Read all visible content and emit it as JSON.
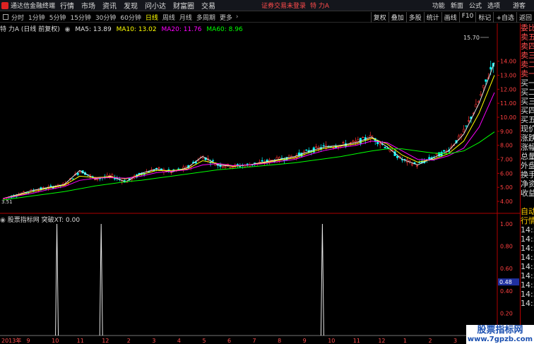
{
  "app": {
    "title": "通达信金融终端"
  },
  "menu": [
    "行情",
    "市场",
    "资讯",
    "发现",
    "问小达",
    "财富圈",
    "交易"
  ],
  "notice": "证券交易未登录",
  "stock_name": "特 力A",
  "top_right": [
    "功能",
    "新面",
    "公式",
    "选项"
  ],
  "guest": "游客",
  "periods": [
    "分时",
    "1分钟",
    "5分钟",
    "15分钟",
    "30分钟",
    "60分钟",
    "日线",
    "周线",
    "月线",
    "多周期",
    "更多"
  ],
  "active_period": "日线",
  "tools": [
    "复权",
    "叠加",
    "多股",
    "统计",
    "画线",
    "F10",
    "标记",
    "+自选",
    "返回"
  ],
  "info": {
    "title": "特 力A (日线 前复权)",
    "ma5": "MA5: 13.89",
    "ma10": "MA10: 13.02",
    "ma20": "MA20: 11.76",
    "ma60": "MA60: 8.96"
  },
  "indicator": {
    "title": "股票指标网",
    "line": "突破XT: 0.00",
    "current_value": "0.48",
    "y_labels": [
      "1.00",
      "0.80",
      "0.60",
      "0.40",
      "0.20"
    ]
  },
  "price_axis": [
    "14.00",
    "13.00",
    "12.00",
    "11.00",
    "10.00",
    "9.00",
    "8.00",
    "7.00",
    "6.00",
    "5.00",
    "4.00"
  ],
  "peak_label": "15.70",
  "low_label": "3.51",
  "quote_panel": [
    "委比",
    "卖五",
    "卖四",
    "卖三",
    "卖二",
    "卖一",
    "买一",
    "买二",
    "买三",
    "买四",
    "买五",
    "现价",
    "涨跌",
    "涨幅",
    "总量",
    "外盘",
    "换手",
    "净资",
    "收益",
    "",
    "自动",
    "行情",
    "14:56",
    "14:56",
    "14:56",
    "14:56",
    "14:56",
    "14:56",
    "14:56",
    "14:56",
    "14:56"
  ],
  "date_axis": [
    "2013年",
    "9",
    "10",
    "11",
    "12",
    "2",
    "3",
    "4",
    "5",
    "6",
    "7",
    "8",
    "9",
    "10",
    "11",
    "12",
    "1",
    "2",
    "3"
  ],
  "watermark": {
    "line1": "股票指标网",
    "line2": "www.7gpzb.com"
  },
  "colors": {
    "up": "#ff3030",
    "down": "#00ffff",
    "ma5": "#e0e0e0",
    "ma10": "#ffff00",
    "ma20": "#ff00ff",
    "ma60": "#00ff00",
    "axis": "#b00000"
  },
  "chart_data": {
    "type": "line",
    "series": [
      {
        "name": "MA5",
        "values": [
          4.2,
          4.5,
          4.8,
          5.0,
          5.2,
          6.2,
          5.6,
          5.8,
          5.4,
          6.0,
          6.3,
          6.1,
          6.4,
          7.2,
          6.6,
          6.5,
          6.6,
          6.8,
          7.0,
          7.2,
          7.6,
          7.9,
          8.0,
          8.2,
          8.6,
          7.9,
          7.0,
          6.6,
          7.1,
          7.6,
          8.8,
          11.0,
          13.9
        ]
      },
      {
        "name": "MA10",
        "values": [
          4.2,
          4.45,
          4.7,
          4.95,
          5.15,
          5.8,
          5.7,
          5.75,
          5.6,
          5.9,
          6.2,
          6.2,
          6.3,
          6.9,
          6.7,
          6.5,
          6.6,
          6.75,
          6.95,
          7.1,
          7.5,
          7.8,
          7.95,
          8.1,
          8.5,
          8.1,
          7.3,
          6.8,
          7.0,
          7.4,
          8.3,
          10.3,
          13.0
        ]
      },
      {
        "name": "MA20",
        "values": [
          4.2,
          4.4,
          4.6,
          4.85,
          5.05,
          5.5,
          5.65,
          5.7,
          5.65,
          5.8,
          6.05,
          6.15,
          6.25,
          6.6,
          6.7,
          6.55,
          6.6,
          6.7,
          6.85,
          7.0,
          7.35,
          7.65,
          7.85,
          8.0,
          8.3,
          8.2,
          7.6,
          7.0,
          6.95,
          7.25,
          7.8,
          9.3,
          11.76
        ]
      },
      {
        "name": "MA60",
        "values": [
          4.1,
          4.25,
          4.4,
          4.55,
          4.7,
          4.9,
          5.1,
          5.25,
          5.4,
          5.5,
          5.65,
          5.8,
          5.95,
          6.1,
          6.25,
          6.35,
          6.45,
          6.55,
          6.65,
          6.75,
          6.9,
          7.05,
          7.2,
          7.4,
          7.6,
          7.75,
          7.75,
          7.6,
          7.45,
          7.4,
          7.6,
          8.2,
          8.96
        ]
      }
    ],
    "ylim": [
      3.5,
      16.0
    ],
    "xlabel": "",
    "ylabel": "",
    "indicator_spikes_at": [
      0.11,
      0.2,
      0.65
    ],
    "grid": false
  }
}
